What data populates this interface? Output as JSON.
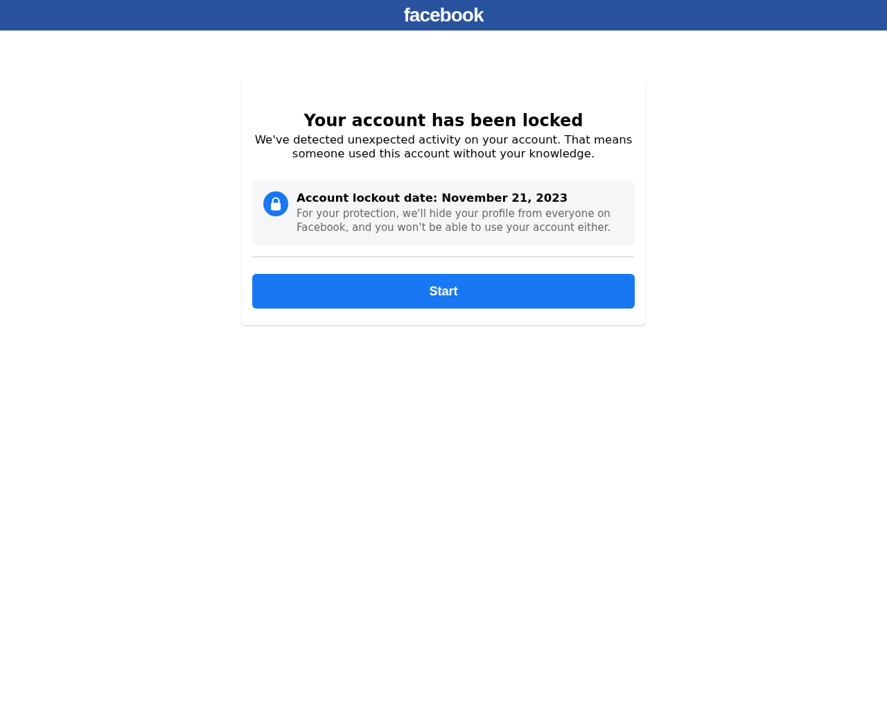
{
  "header": {
    "logo": "facebook"
  },
  "card": {
    "title": "Your account has been locked",
    "description": "We've detected unexpected activity on your account. That means someone used this account without your knowledge.",
    "notice": {
      "title": "Account lockout date: November 21, 2023",
      "text": "For your protection, we'll hide your profile from everyone on Facebook, and you won't be able to use your account either."
    },
    "button": "Start"
  }
}
